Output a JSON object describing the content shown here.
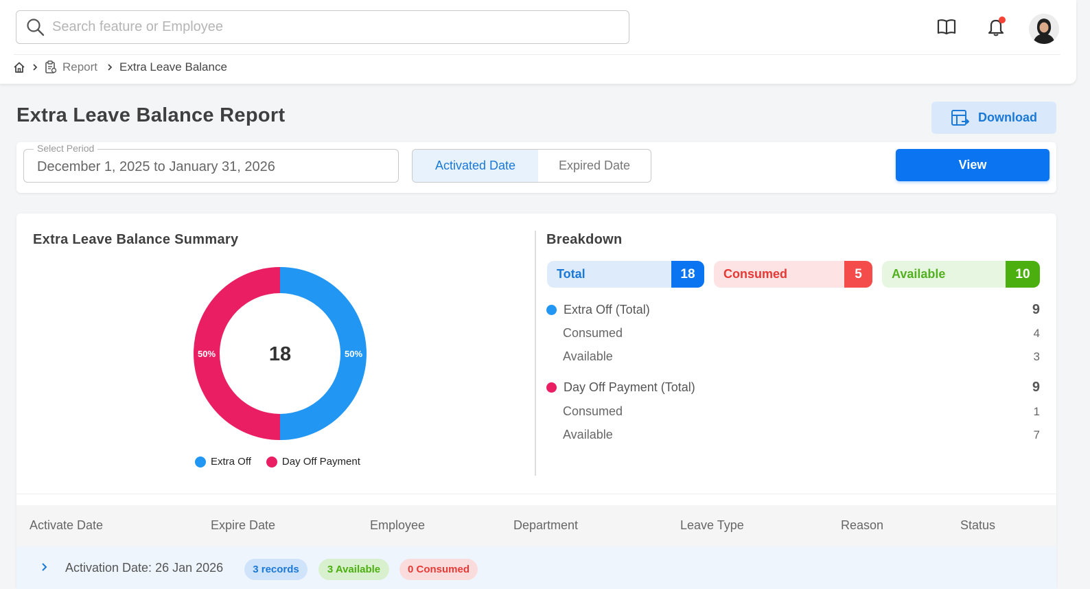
{
  "search": {
    "placeholder": "Search feature or Employee"
  },
  "header_icons": [
    "book-icon",
    "bell-icon",
    "avatar"
  ],
  "breadcrumb": {
    "items": [
      "Report",
      "Extra Leave Balance"
    ]
  },
  "page": {
    "title": "Extra Leave Balance Report",
    "download_label": "Download"
  },
  "filter": {
    "period_label": "Select Period",
    "period_value": "December 1, 2025 to January 31, 2026",
    "toggle": [
      "Activated Date",
      "Expired Date"
    ],
    "toggle_selected": "Activated Date",
    "view_label": "View"
  },
  "summary": {
    "title": "Extra Leave Balance Summary",
    "center_value": "18",
    "legend": [
      "Extra Off",
      "Day Off Payment"
    ],
    "slice_labels": [
      "50%",
      "50%"
    ]
  },
  "chart_data": {
    "type": "pie",
    "categories": [
      "Extra Off",
      "Day Off Payment"
    ],
    "values": [
      9,
      9
    ],
    "percent_labels": [
      "50%",
      "50%"
    ],
    "center_label": "18",
    "colors": [
      "#2196f3",
      "#e91e63"
    ],
    "donut": true,
    "legend": "bottom"
  },
  "breakdown": {
    "title": "Breakdown",
    "pills": {
      "total_label": "Total",
      "total_value": "18",
      "consumed_label": "Consumed",
      "consumed_value": "5",
      "available_label": "Available",
      "available_value": "10"
    },
    "groups": [
      {
        "name": "Extra Off (Total)",
        "total": "9",
        "consumed_label": "Consumed",
        "consumed": "4",
        "available_label": "Available",
        "available": "3",
        "color": "#2196f3"
      },
      {
        "name": "Day Off Payment (Total)",
        "total": "9",
        "consumed_label": "Consumed",
        "consumed": "1",
        "available_label": "Available",
        "available": "7",
        "color": "#e91e63"
      }
    ]
  },
  "table": {
    "columns": [
      "Activate Date",
      "Expire Date",
      "Employee",
      "Department",
      "Leave Type",
      "Reason",
      "Status"
    ],
    "group_row": {
      "title": "Activation Date: 26 Jan 2026",
      "records": "3 records",
      "available": "3 Available",
      "consumed": "0 Consumed"
    }
  },
  "colors": {
    "primary": "#0b74f1",
    "extra_off": "#2196f3",
    "day_off_payment": "#e91e63",
    "consumed": "#f44b4b",
    "available": "#4caf10"
  }
}
